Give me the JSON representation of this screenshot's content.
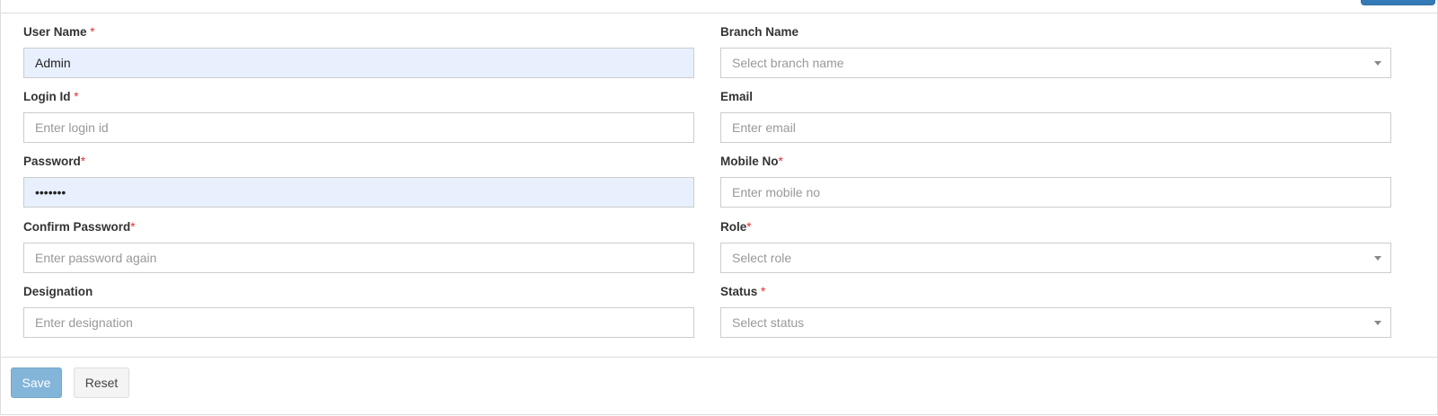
{
  "form": {
    "left": [
      {
        "label": "User Name",
        "required": " *",
        "value": "Admin",
        "placeholder": "",
        "kind": "text",
        "filled": true
      },
      {
        "label": "Login Id",
        "required": " *",
        "value": "",
        "placeholder": "Enter login id",
        "kind": "text",
        "filled": false
      },
      {
        "label": "Password",
        "required": "*",
        "value": "•••••••",
        "placeholder": "",
        "kind": "password",
        "filled": true
      },
      {
        "label": "Confirm Password",
        "required": "*",
        "value": "",
        "placeholder": "Enter password again",
        "kind": "password",
        "filled": false
      },
      {
        "label": "Designation",
        "required": "",
        "value": "",
        "placeholder": "Enter designation",
        "kind": "text",
        "filled": false
      }
    ],
    "right": [
      {
        "label": "Branch Name",
        "required": "",
        "value": "",
        "placeholder": "Select branch name",
        "kind": "select",
        "filled": false
      },
      {
        "label": "Email",
        "required": "",
        "value": "",
        "placeholder": "Enter email",
        "kind": "text",
        "filled": false
      },
      {
        "label": "Mobile No",
        "required": "*",
        "value": "",
        "placeholder": "Enter mobile no",
        "kind": "text",
        "filled": false
      },
      {
        "label": "Role",
        "required": "*",
        "value": "",
        "placeholder": "Select role",
        "kind": "select",
        "filled": false
      },
      {
        "label": "Status",
        "required": " *",
        "value": "",
        "placeholder": "Select status",
        "kind": "select",
        "filled": false
      }
    ]
  },
  "actions": {
    "save_label": "Save",
    "reset_label": "Reset"
  },
  "colors": {
    "primary": "#337ab7",
    "save_disabled": "#83b5d8",
    "required": "#e03030",
    "autofill": "#e8f0fe"
  },
  "icons": {
    "dropdown": "caret-down-icon"
  }
}
